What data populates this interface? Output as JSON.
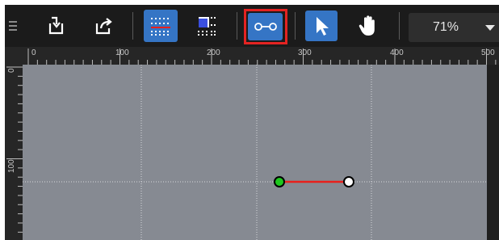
{
  "toolbar": {
    "buttons": [
      {
        "name": "menu",
        "icon": "drag-handle-icon"
      },
      {
        "name": "import",
        "icon": "import-icon"
      },
      {
        "name": "export",
        "icon": "export-icon"
      },
      {
        "name": "grid-toggle",
        "icon": "grid-icon",
        "active": true
      },
      {
        "name": "snap-to-grid",
        "icon": "snap-icon"
      },
      {
        "name": "link-tool",
        "icon": "link-icon",
        "active": true,
        "highlighted": true
      },
      {
        "name": "select-tool",
        "icon": "cursor-icon",
        "active": true
      },
      {
        "name": "pan-tool",
        "icon": "hand-icon"
      }
    ],
    "zoom": {
      "value": "71%"
    }
  },
  "rulers": {
    "horizontal_labels": [
      "0",
      "100",
      "200",
      "300",
      "400",
      "500"
    ],
    "vertical_labels": [
      "0",
      "100"
    ]
  },
  "canvas": {
    "background": "#868a92",
    "segment": {
      "color": "#e8201c",
      "start_handle": "#1ec81e",
      "end_handle": "#ffffff"
    }
  },
  "colors": {
    "accent": "#3575c5",
    "highlight": "#e32322",
    "toolbar_bg": "#1b1b1b"
  }
}
